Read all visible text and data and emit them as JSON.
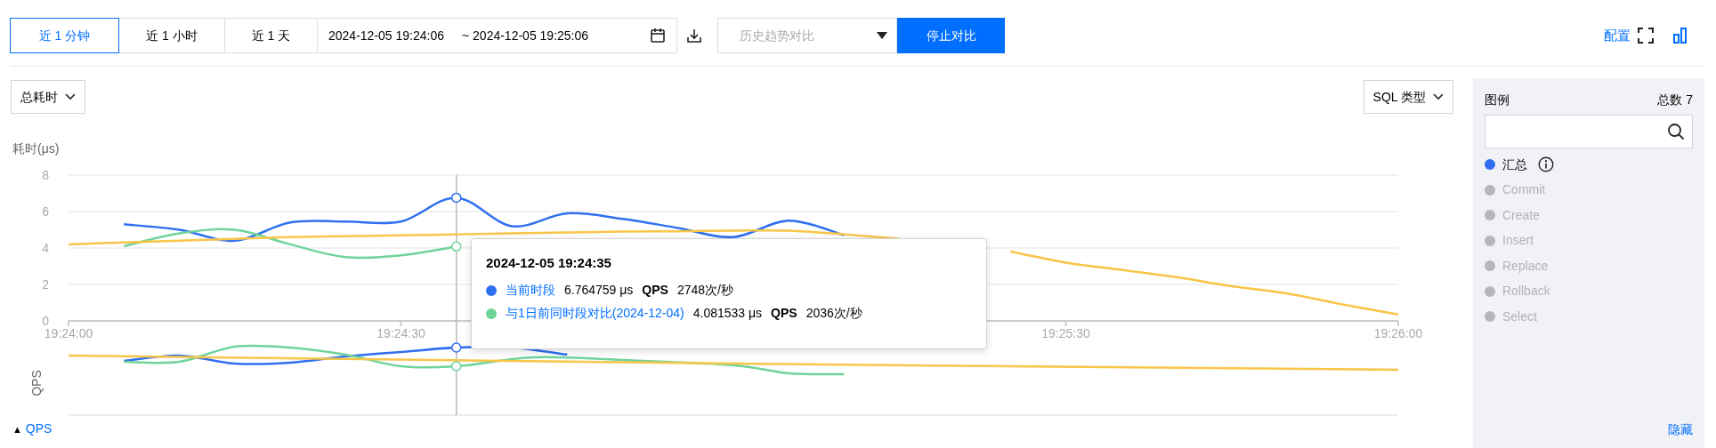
{
  "toolbar": {
    "time_tabs": [
      {
        "label": "近 1 分钟",
        "selected": true
      },
      {
        "label": "近 1 小时",
        "selected": false
      },
      {
        "label": "近 1 天",
        "selected": false
      }
    ],
    "date_range": {
      "start": "2024-12-05 19:24:06",
      "end": "~ 2024-12-05 19:25:06"
    },
    "compare_select": {
      "placeholder": "历史趋势对比"
    },
    "stop_button": "停止对比",
    "config_link": "配置"
  },
  "metric_select": "总耗时",
  "group_select": "SQL 类型",
  "chart": {
    "chart_data": {
      "type": "line",
      "ylabel": "耗时(μs)",
      "categories": [
        "19:24:00",
        null,
        null,
        null,
        null,
        null,
        "19:24:30",
        null,
        null,
        null,
        null,
        null,
        null,
        null,
        null,
        null,
        null,
        null,
        "19:25:30",
        null,
        null,
        null,
        null,
        null,
        "19:26:00"
      ],
      "ylim": [
        0,
        8
      ],
      "yticks": [
        0,
        2,
        4,
        6,
        8
      ],
      "series": [
        {
          "color": "#2f6ff0",
          "values": [
            null,
            5.3,
            5.0,
            4.4,
            5.4,
            5.45,
            5.45,
            6.76,
            5.2,
            5.9,
            5.6,
            5.1,
            4.6,
            5.5,
            4.7,
            null,
            null,
            null,
            null,
            null,
            null,
            null,
            null,
            null,
            null
          ]
        },
        {
          "color": "#6fd39a",
          "values": [
            null,
            4.1,
            4.8,
            5.0,
            4.2,
            3.5,
            3.6,
            4.08,
            null,
            null,
            null,
            null,
            null,
            null,
            null,
            null,
            null,
            null,
            null,
            null,
            null,
            null,
            null,
            null,
            null
          ]
        },
        {
          "color": "#f7c548",
          "values": [
            4.2,
            4.3,
            4.4,
            4.5,
            4.6,
            4.65,
            4.7,
            4.75,
            4.8,
            4.85,
            4.9,
            4.92,
            4.95,
            4.95,
            4.75,
            4.5,
            null,
            3.8,
            3.2,
            2.8,
            2.4,
            1.9,
            1.5,
            0.9,
            0.35
          ]
        }
      ],
      "grid": true
    }
  },
  "qps_chart": {
    "axis_label": "QPS"
  },
  "qps_toggle": {
    "icon": "▲",
    "label": "QPS"
  },
  "tooltip": {
    "time": "2024-12-05 19:24:35",
    "rows": [
      {
        "name": "当前时段",
        "value": "6.764759 μs",
        "qps_label": "QPS",
        "qps_value": "2748次/秒",
        "color": "#2f6ff0"
      },
      {
        "name": "与1日前同时段对比(2024-12-04)",
        "value": "4.081533 μs",
        "qps_label": "QPS",
        "qps_value": "2036次/秒",
        "color": "#6fd39a"
      }
    ]
  },
  "legend": {
    "title": "图例",
    "total": "总数 7",
    "items": [
      {
        "label": "汇总",
        "selected": true,
        "has_info": true
      },
      {
        "label": "Commit",
        "selected": false,
        "has_info": false
      },
      {
        "label": "Create",
        "selected": false,
        "has_info": false
      },
      {
        "label": "Insert",
        "selected": false,
        "has_info": false
      },
      {
        "label": "Replace",
        "selected": false,
        "has_info": false
      },
      {
        "label": "Rollback",
        "selected": false,
        "has_info": false
      },
      {
        "label": "Select",
        "selected": false,
        "has_info": false
      }
    ],
    "hide_link": "隐藏"
  }
}
